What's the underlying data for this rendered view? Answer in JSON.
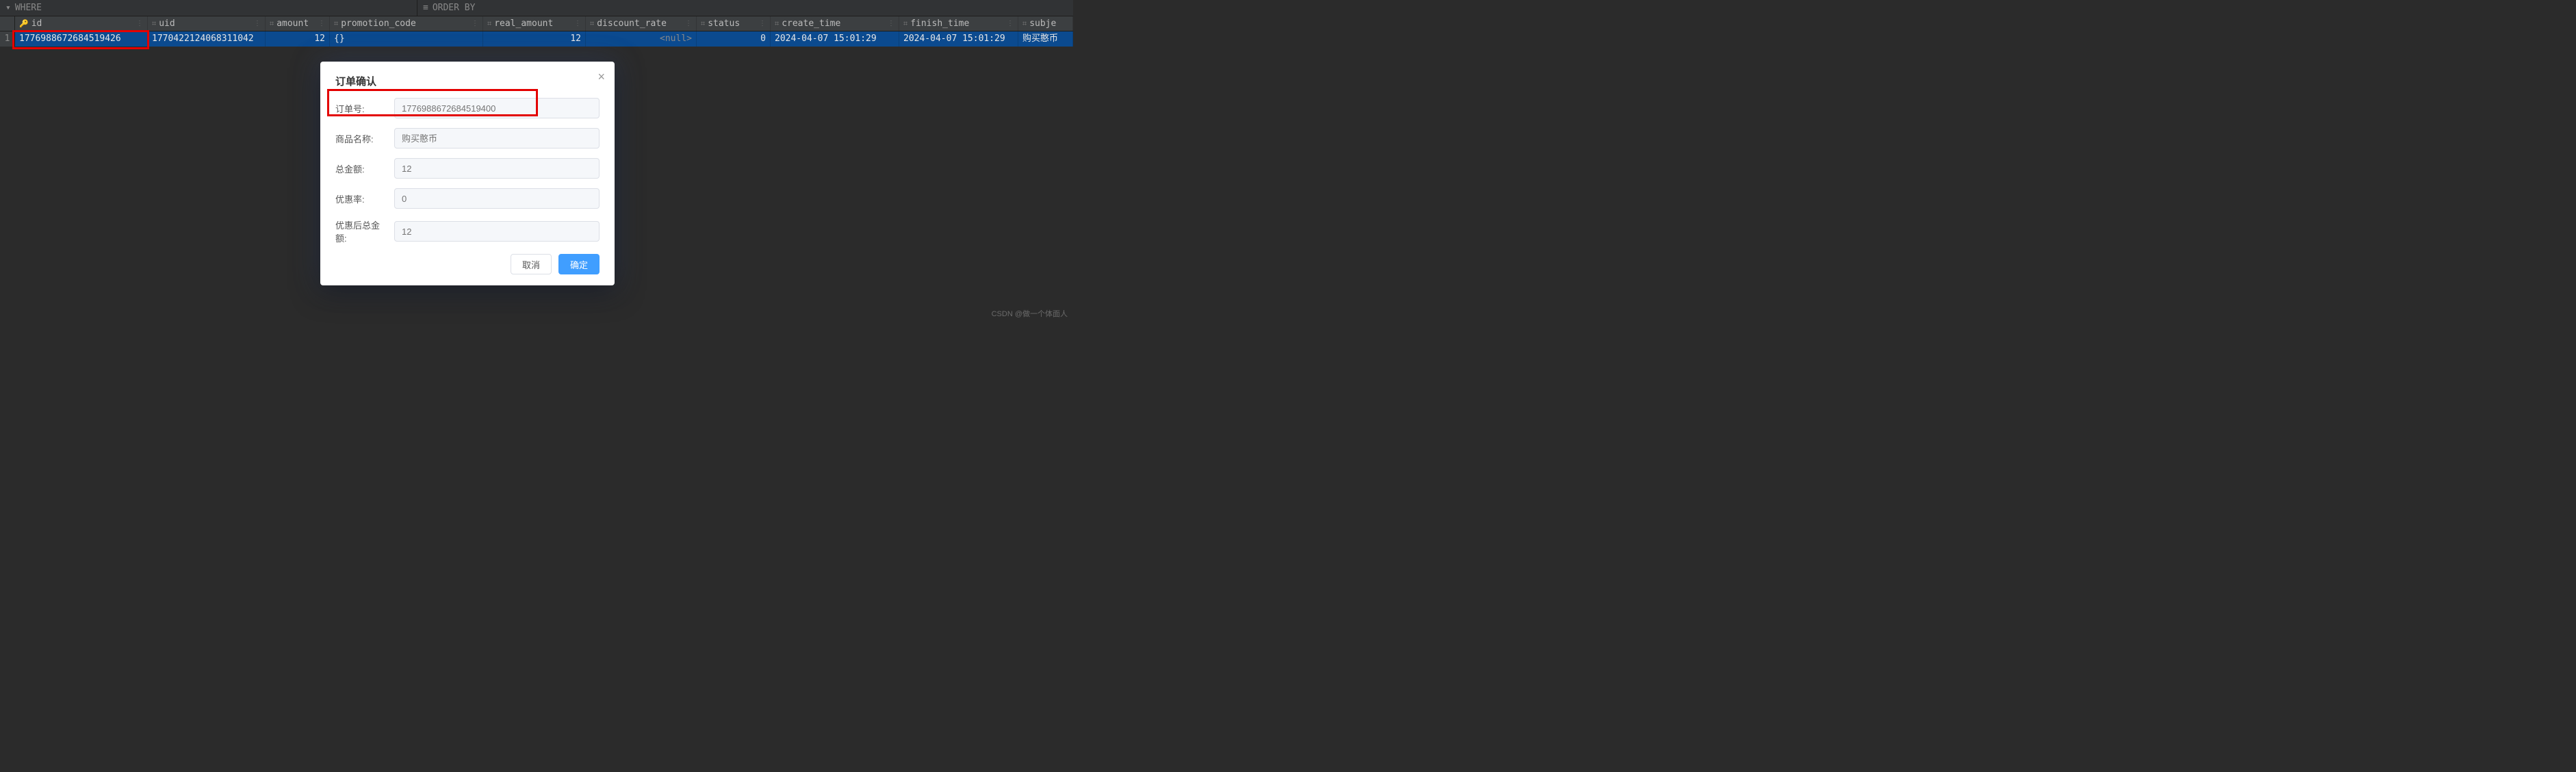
{
  "filter": {
    "where_label": "WHERE",
    "orderby_label": "ORDER BY"
  },
  "columns": {
    "id": "id",
    "uid": "uid",
    "amount": "amount",
    "promotion_code": "promotion_code",
    "real_amount": "real_amount",
    "discount_rate": "discount_rate",
    "status": "status",
    "create_time": "create_time",
    "finish_time": "finish_time",
    "subject": "subje"
  },
  "row_index": "1",
  "row": {
    "id": "1776988672684519426",
    "uid": "1770422124068311042",
    "amount": "12",
    "promotion_code": "{}",
    "real_amount": "12",
    "discount_rate": "<null>",
    "status": "0",
    "create_time": "2024-04-07 15:01:29",
    "finish_time": "2024-04-07 15:01:29",
    "subject": "购买憨币"
  },
  "modal": {
    "title": "订单确认",
    "close": "×",
    "fields": {
      "order_no_label": "订单号:",
      "order_no_placeholder": "1776988672684519400",
      "product_label": "商品名称:",
      "product_placeholder": "购买憨币",
      "total_label": "总金额:",
      "total_placeholder": "12",
      "discount_label": "优惠率:",
      "discount_placeholder": "0",
      "final_label": "优惠后总金额:",
      "final_placeholder": "12"
    },
    "cancel": "取消",
    "confirm": "确定"
  },
  "watermark": "CSDN @做一个体面人"
}
